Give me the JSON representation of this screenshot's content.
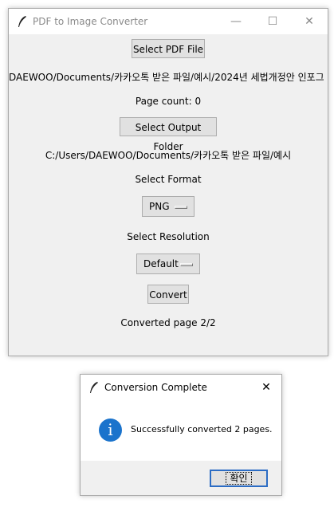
{
  "main_window": {
    "title": "PDF to Image Converter",
    "controls": {
      "minimize": "—",
      "maximize": "☐",
      "close": "✕"
    },
    "select_pdf_label": "Select PDF File",
    "pdf_path": "DAEWOO/Documents/카카오톡 받은 파일/예시/2024년 세법개정안 인포그",
    "page_count": "Page count: 0",
    "select_output_label": "Select Output Folder",
    "output_path": "C:/Users/DAEWOO/Documents/카카오톡 받은 파일/예시",
    "format_label": "Select Format",
    "format_value": "PNG",
    "resolution_label": "Select Resolution",
    "resolution_value": "Default",
    "convert_label": "Convert",
    "status": "Converted page 2/2"
  },
  "dialog": {
    "title": "Conversion Complete",
    "close": "✕",
    "icon_glyph": "i",
    "message": "Successfully converted 2 pages.",
    "ok_label": "확인"
  },
  "colors": {
    "window_bg": "#f0f0f0",
    "button_bg": "#e1e1e1",
    "info_icon": "#1a73cc",
    "focus_border": "#2b6cc4"
  }
}
